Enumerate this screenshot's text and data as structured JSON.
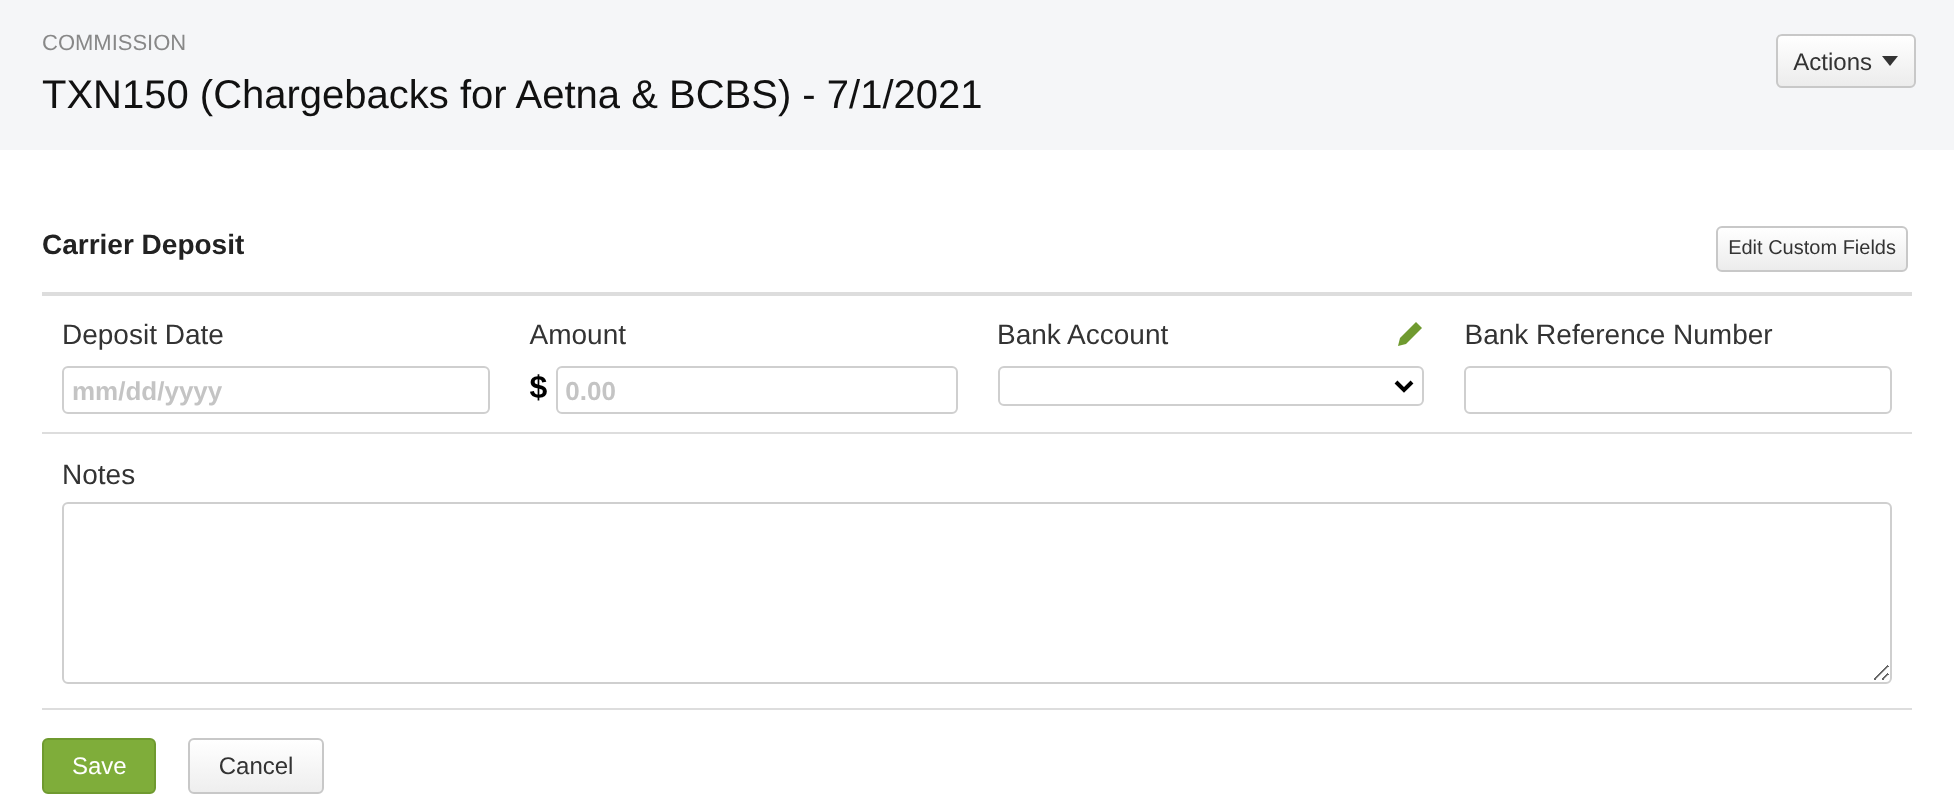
{
  "header": {
    "eyebrow": "COMMISSION",
    "title": "TXN150 (Chargebacks for Aetna & BCBS) - 7/1/2021",
    "actions_button": "Actions"
  },
  "section": {
    "title": "Carrier Deposit",
    "edit_button": "Edit Custom Fields"
  },
  "fields": [
    {
      "kind": "date",
      "label": "Deposit Date",
      "placeholder": "mm/dd/yyyy",
      "editable": false
    },
    {
      "kind": "currency",
      "label": "Amount",
      "prefix": "$",
      "placeholder": "0.00",
      "editable": false
    },
    {
      "kind": "select",
      "label": "Bank Account",
      "editable": true
    },
    {
      "kind": "text",
      "label": "Bank Reference Number",
      "editable": false
    }
  ],
  "notes": {
    "label": "Notes"
  },
  "buttons": [
    {
      "kind": "primary",
      "label": "Save"
    },
    {
      "kind": "secondary",
      "label": "Cancel"
    }
  ]
}
